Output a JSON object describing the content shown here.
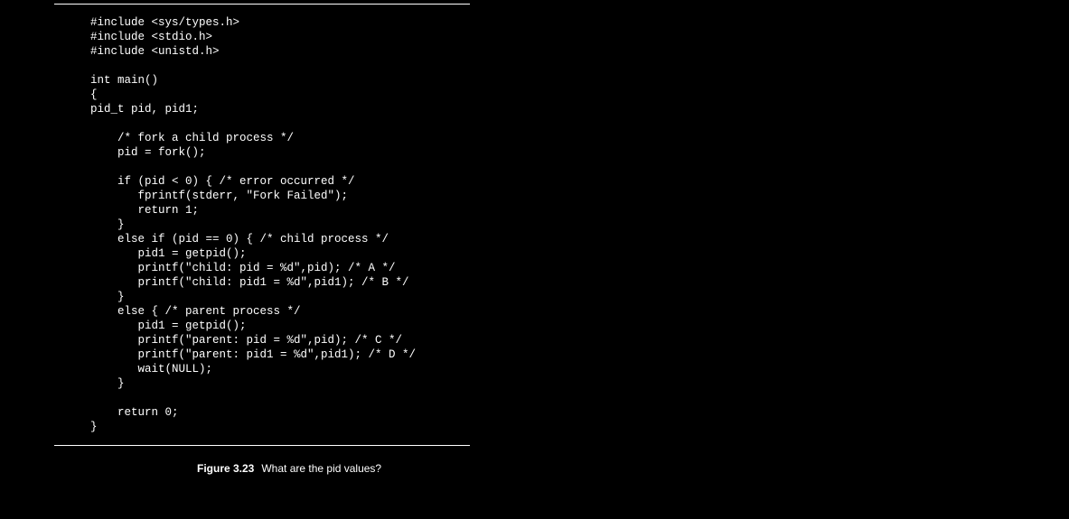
{
  "figure": {
    "number_label": "Figure 3.23",
    "caption_text": "What are the pid values?"
  },
  "code": {
    "lines": [
      "#include <sys/types.h>",
      "#include <stdio.h>",
      "#include <unistd.h>",
      "",
      "int main()",
      "{",
      "pid_t pid, pid1;",
      "",
      "    /* fork a child process */",
      "    pid = fork();",
      "",
      "    if (pid < 0) { /* error occurred */",
      "       fprintf(stderr, \"Fork Failed\");",
      "       return 1;",
      "    }",
      "    else if (pid == 0) { /* child process */",
      "       pid1 = getpid();",
      "       printf(\"child: pid = %d\",pid); /* A */",
      "       printf(\"child: pid1 = %d\",pid1); /* B */",
      "    }",
      "    else { /* parent process */",
      "       pid1 = getpid();",
      "       printf(\"parent: pid = %d\",pid); /* C */",
      "       printf(\"parent: pid1 = %d\",pid1); /* D */",
      "       wait(NULL);",
      "    }",
      "",
      "    return 0;",
      "}"
    ]
  }
}
